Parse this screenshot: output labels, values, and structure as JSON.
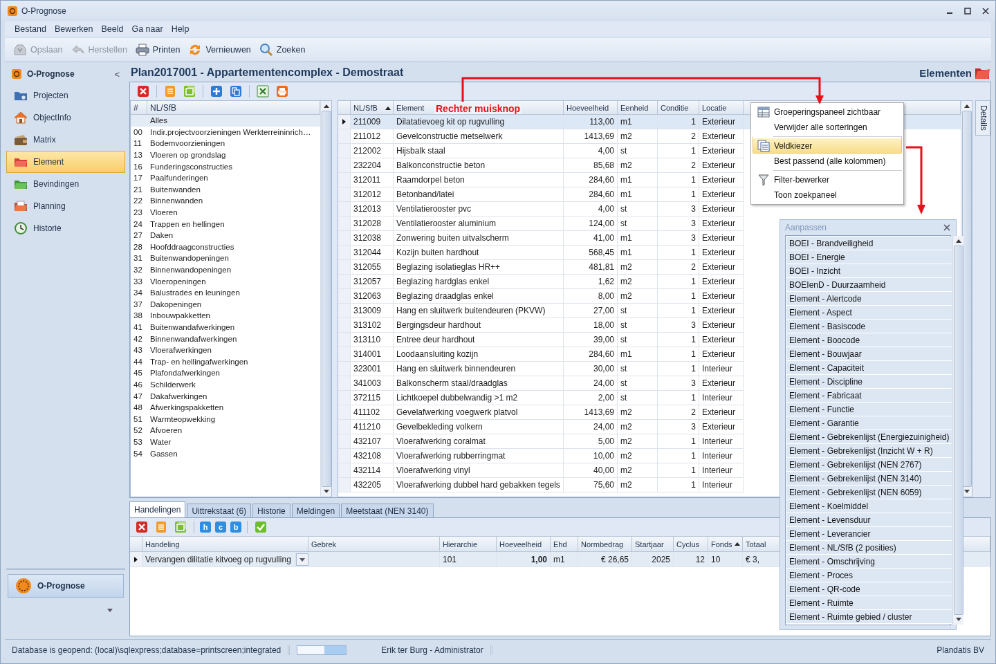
{
  "window": {
    "title": "O-Prognose"
  },
  "menu": [
    "Bestand",
    "Bewerken",
    "Beeld",
    "Ga naar",
    "Help"
  ],
  "toolbar": [
    {
      "label": "Opslaan",
      "disabled": true
    },
    {
      "label": "Herstellen",
      "disabled": true
    },
    {
      "label": "Printen",
      "disabled": false
    },
    {
      "label": "Vernieuwen",
      "disabled": false
    },
    {
      "label": "Zoeken",
      "disabled": false
    }
  ],
  "sidebar": {
    "title": "O-Prognose",
    "collapse": "<",
    "items": [
      {
        "label": "Projecten",
        "selected": false
      },
      {
        "label": "ObjectInfo",
        "selected": false
      },
      {
        "label": "Matrix",
        "selected": false
      },
      {
        "label": "Element",
        "selected": true
      },
      {
        "label": "Bevindingen",
        "selected": false
      },
      {
        "label": "Planning",
        "selected": false
      },
      {
        "label": "Historie",
        "selected": false
      }
    ],
    "footer_button": "O-Prognose"
  },
  "header": {
    "title": "Plan2017001 - Appartementencomplex - Demostraat",
    "section": "Elementen"
  },
  "tree": {
    "columns": [
      "#",
      "NL/SfB"
    ],
    "items": [
      {
        "label": "Alles",
        "selected": true
      },
      {
        "code": "00",
        "label": "Indir.projectvoorzieningen Werkterreininrich…",
        "selected": false
      },
      {
        "code": "11",
        "label": "Bodemvoorzieningen",
        "selected": false
      },
      {
        "code": "13",
        "label": "Vloeren op grondslag",
        "selected": false
      },
      {
        "code": "16",
        "label": "Funderingsconstructies",
        "selected": false
      },
      {
        "code": "17",
        "label": "Paalfunderingen",
        "selected": false
      },
      {
        "code": "21",
        "label": "Buitenwanden",
        "selected": false
      },
      {
        "code": "22",
        "label": "Binnenwanden",
        "selected": false
      },
      {
        "code": "23",
        "label": "Vloeren",
        "selected": false
      },
      {
        "code": "24",
        "label": "Trappen en hellingen",
        "selected": false
      },
      {
        "code": "27",
        "label": "Daken",
        "selected": false
      },
      {
        "code": "28",
        "label": "Hoofddraagconstructies",
        "selected": false
      },
      {
        "code": "31",
        "label": "Buitenwandopeningen",
        "selected": false
      },
      {
        "code": "32",
        "label": "Binnenwandopeningen",
        "selected": false
      },
      {
        "code": "33",
        "label": "Vloeropeningen",
        "selected": false
      },
      {
        "code": "34",
        "label": "Balustrades en leuningen",
        "selected": false
      },
      {
        "code": "37",
        "label": "Dakopeningen",
        "selected": false
      },
      {
        "code": "38",
        "label": "Inbouwpakketten",
        "selected": false
      },
      {
        "code": "41",
        "label": "Buitenwandafwerkingen",
        "selected": false
      },
      {
        "code": "42",
        "label": "Binnenwandafwerkingen",
        "selected": false
      },
      {
        "code": "43",
        "label": "Vloerafwerkingen",
        "selected": false
      },
      {
        "code": "44",
        "label": "Trap- en hellingafwerkingen",
        "selected": false
      },
      {
        "code": "45",
        "label": "Plafondafwerkingen",
        "selected": false
      },
      {
        "code": "46",
        "label": "Schilderwerk",
        "selected": false
      },
      {
        "code": "47",
        "label": "Dakafwerkingen",
        "selected": false
      },
      {
        "code": "48",
        "label": "Afwerkingspakketten",
        "selected": false
      },
      {
        "code": "51",
        "label": "Warmteopwekking",
        "selected": false
      },
      {
        "code": "52",
        "label": "Afvoeren",
        "selected": false
      },
      {
        "code": "53",
        "label": "Water",
        "selected": false
      },
      {
        "code": "54",
        "label": "Gassen",
        "selected": false
      }
    ]
  },
  "table": {
    "annotation": "Rechter muisknop",
    "columns": [
      {
        "label": "NL/SfB",
        "sorted": true
      },
      {
        "label": "Element",
        "sorted": false
      },
      {
        "label": "Hoeveelheid",
        "sorted": false
      },
      {
        "label": "Eenheid",
        "sorted": false
      },
      {
        "label": "Conditie",
        "sorted": false
      },
      {
        "label": "Locatie",
        "sorted": false
      }
    ],
    "rows": [
      {
        "selected": true,
        "cells": [
          "211009",
          "Dilatatievoeg kit op rugvulling",
          "113,00",
          "m1",
          "1",
          "Exterieur"
        ]
      },
      {
        "selected": false,
        "cells": [
          "211012",
          "Gevelconstructie metselwerk",
          "1413,69",
          "m2",
          "2",
          "Exterieur"
        ]
      },
      {
        "selected": false,
        "cells": [
          "212002",
          "Hijsbalk staal",
          "4,00",
          "st",
          "1",
          "Exterieur"
        ]
      },
      {
        "selected": false,
        "cells": [
          "232204",
          "Balkonconstructie beton",
          "85,68",
          "m2",
          "2",
          "Exterieur"
        ]
      },
      {
        "selected": false,
        "cells": [
          "312011",
          "Raamdorpel beton",
          "284,60",
          "m1",
          "1",
          "Exterieur"
        ]
      },
      {
        "selected": false,
        "cells": [
          "312012",
          "Betonband/latei",
          "284,60",
          "m1",
          "1",
          "Exterieur"
        ]
      },
      {
        "selected": false,
        "cells": [
          "312013",
          "Ventilatierooster pvc",
          "4,00",
          "st",
          "3",
          "Exterieur"
        ]
      },
      {
        "selected": false,
        "cells": [
          "312028",
          "Ventilatierooster aluminium",
          "124,00",
          "st",
          "3",
          "Exterieur"
        ]
      },
      {
        "selected": false,
        "cells": [
          "312038",
          "Zonwering buiten uitvalscherm",
          "41,00",
          "m1",
          "3",
          "Exterieur"
        ]
      },
      {
        "selected": false,
        "cells": [
          "312044",
          "Kozijn buiten hardhout",
          "568,45",
          "m1",
          "1",
          "Exterieur"
        ]
      },
      {
        "selected": false,
        "cells": [
          "312055",
          "Beglazing isolatieglas HR++",
          "481,81",
          "m2",
          "2",
          "Exterieur"
        ]
      },
      {
        "selected": false,
        "cells": [
          "312057",
          "Beglazing hardglas enkel",
          "1,62",
          "m2",
          "1",
          "Exterieur"
        ]
      },
      {
        "selected": false,
        "cells": [
          "312063",
          "Beglazing draadglas enkel",
          "8,00",
          "m2",
          "1",
          "Exterieur"
        ]
      },
      {
        "selected": false,
        "cells": [
          "313009",
          "Hang en sluitwerk buitendeuren (PKVW)",
          "27,00",
          "st",
          "1",
          "Exterieur"
        ]
      },
      {
        "selected": false,
        "cells": [
          "313102",
          "Bergingsdeur hardhout",
          "18,00",
          "st",
          "3",
          "Exterieur"
        ]
      },
      {
        "selected": false,
        "cells": [
          "313110",
          "Entree deur hardhout",
          "39,00",
          "st",
          "1",
          "Exterieur"
        ]
      },
      {
        "selected": false,
        "cells": [
          "314001",
          "Loodaansluiting kozijn",
          "284,60",
          "m1",
          "1",
          "Exterieur"
        ]
      },
      {
        "selected": false,
        "cells": [
          "323001",
          "Hang en sluitwerk binnendeuren",
          "30,00",
          "st",
          "1",
          "Interieur"
        ]
      },
      {
        "selected": false,
        "cells": [
          "341003",
          "Balkonscherm staal/draadglas",
          "24,00",
          "st",
          "3",
          "Exterieur"
        ]
      },
      {
        "selected": false,
        "cells": [
          "372115",
          "Lichtkoepel dubbelwandig >1 m2",
          "2,00",
          "st",
          "1",
          "Interieur"
        ]
      },
      {
        "selected": false,
        "cells": [
          "411102",
          "Gevelafwerking voegwerk platvol",
          "1413,69",
          "m2",
          "2",
          "Exterieur"
        ]
      },
      {
        "selected": false,
        "cells": [
          "411210",
          "Gevelbekleding volkern",
          "24,00",
          "m2",
          "3",
          "Exterieur"
        ]
      },
      {
        "selected": false,
        "cells": [
          "432107",
          "Vloerafwerking coralmat",
          "5,00",
          "m2",
          "1",
          "Interieur"
        ]
      },
      {
        "selected": false,
        "cells": [
          "432108",
          "Vloerafwerking rubberringmat",
          "10,00",
          "m2",
          "1",
          "Interieur"
        ]
      },
      {
        "selected": false,
        "cells": [
          "432114",
          "Vloerafwerking vinyl",
          "40,00",
          "m2",
          "1",
          "Interieur"
        ]
      },
      {
        "selected": false,
        "cells": [
          "432205",
          "Vloerafwerking dubbel hard gebakken tegels",
          "75,60",
          "m2",
          "1",
          "Interieur"
        ]
      }
    ]
  },
  "details_tab": "Details",
  "context_menu": [
    {
      "label": "Groeperingspaneel zichtbaar",
      "selected": false,
      "separator_before": false
    },
    {
      "label": "Verwijder alle sorteringen",
      "selected": false,
      "separator_before": false
    },
    {
      "label": "Veldkiezer",
      "selected": true,
      "separator_before": true
    },
    {
      "label": "Best passend (alle kolommen)",
      "selected": false,
      "separator_before": false
    },
    {
      "label": "Filter-bewerker",
      "selected": false,
      "separator_before": true
    },
    {
      "label": "Toon zoekpaneel",
      "selected": false,
      "separator_before": false
    }
  ],
  "customize": {
    "title": "Aanpassen",
    "items": [
      "BOEI - Brandveiligheid",
      "BOEI - Energie",
      "BOEI - Inzicht",
      "BOEIenD - Duurzaamheid",
      "Element - Alertcode",
      "Element - Aspect",
      "Element - Basiscode",
      "Element - Boocode",
      "Element - Bouwjaar",
      "Element - Capaciteit",
      "Element - Discipline",
      "Element - Fabricaat",
      "Element - Functie",
      "Element - Garantie",
      "Element - Gebrekenlijst (Energiezuinigheid)",
      "Element - Gebrekenlijst (Inzicht W + R)",
      "Element - Gebrekenlijst (NEN 2767)",
      "Element - Gebrekenlijst (NEN 3140)",
      "Element - Gebrekenlijst (NEN 6059)",
      "Element - Koelmiddel",
      "Element - Levensduur",
      "Element - Leverancier",
      "Element - NL/SfB (2 posities)",
      "Element - Omschrijving",
      "Element - Proces",
      "Element - QR-code",
      "Element - Ruimte",
      "Element - Ruimte gebied / cluster"
    ]
  },
  "bottom": {
    "tabs": [
      {
        "label": "Handelingen",
        "selected": true
      },
      {
        "label": "Uittrekstaat (6)",
        "selected": false
      },
      {
        "label": "Historie",
        "selected": false
      },
      {
        "label": "Meldingen",
        "selected": false
      },
      {
        "label": "Meetstaat (NEN 3140)",
        "selected": false
      }
    ],
    "letter_buttons": [
      "h",
      "c",
      "b"
    ],
    "columns": [
      {
        "label": "Handeling",
        "sorted": false
      },
      {
        "label": "Gebrek",
        "sorted": false
      },
      {
        "label": "Hierarchie",
        "sorted": false
      },
      {
        "label": "Hoeveelheid",
        "sorted": false
      },
      {
        "label": "Ehd",
        "sorted": false
      },
      {
        "label": "Normbedrag",
        "sorted": false
      },
      {
        "label": "Startjaar",
        "sorted": false
      },
      {
        "label": "Cyclus",
        "sorted": false
      },
      {
        "label": "Fonds",
        "sorted": true
      },
      {
        "label": "Totaal",
        "sorted": false
      }
    ],
    "rows": [
      {
        "selected": true,
        "cells": [
          "Vervangen dilitatie kitvoeg op rugvulling",
          "",
          "101",
          "1,00",
          "m1",
          "€ 26,65",
          "2025",
          "12",
          "10",
          "€ 3,"
        ]
      }
    ]
  },
  "status_bar": {
    "progress": {
      "level": 0.45
    },
    "connection": "Database is geopend: (local)\\sqlexpress;database=printscreen;integrated",
    "user": "Erik ter Burg - Administrator",
    "company": "Plandatis BV"
  }
}
